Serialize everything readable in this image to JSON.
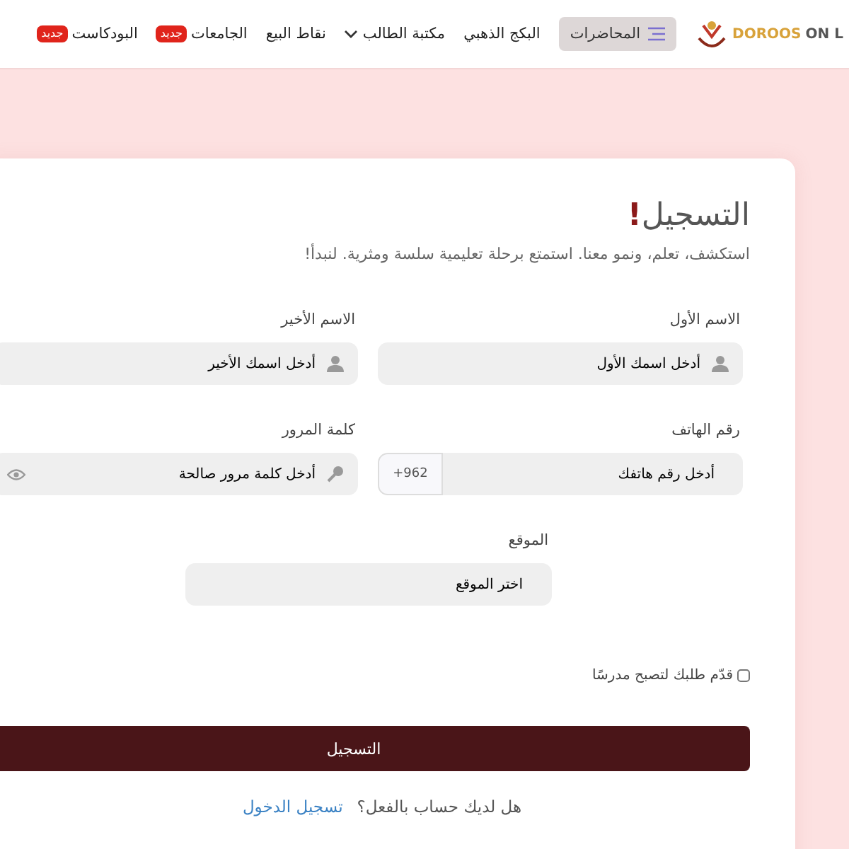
{
  "nav": {
    "brand_primary": "DOROOS",
    "brand_secondary": "ON L",
    "items": [
      {
        "label": "المحاضرات",
        "kind": "menu-button"
      },
      {
        "label": "البكج الذهبي",
        "kind": "link"
      },
      {
        "label": "مكتبة الطالب",
        "kind": "dropdown"
      },
      {
        "label": "نقاط البيع",
        "kind": "link"
      },
      {
        "label": "الجامعات",
        "kind": "badge",
        "badge": "جديد"
      },
      {
        "label": "البودكاست",
        "kind": "badge",
        "badge": "جديد"
      }
    ]
  },
  "form": {
    "title": "التسجيل",
    "title_mark": "!",
    "subtitle": "استكشف، تعلم، ونمو معنا. استمتع برحلة تعليمية سلسة ومثرية. لنبدأ!",
    "fields": [
      {
        "label": "الاسم الأول",
        "placeholder": "أدخل اسمك الأول",
        "kind": "name"
      },
      {
        "label": "الاسم الأخير",
        "placeholder": "أدخل اسمك الأخير",
        "kind": "name"
      },
      {
        "label": "رقم الهاتف",
        "placeholder": "أدخل رقم هاتفك",
        "kind": "phone",
        "prefix": "+962"
      },
      {
        "label": "كلمة المرور",
        "placeholder": "أدخل كلمة مرور صالحة",
        "kind": "password"
      },
      {
        "label": "الموقع",
        "placeholder": "اختر الموقع",
        "kind": "select"
      }
    ],
    "teacher_checkbox": {
      "label": "قدّم طلبك لتصبح مدرسًا",
      "checked": false
    },
    "submit": "التسجيل",
    "login_prompt": "هل لديك حساب بالفعل؟",
    "login_link": "تسجيل الدخول"
  }
}
